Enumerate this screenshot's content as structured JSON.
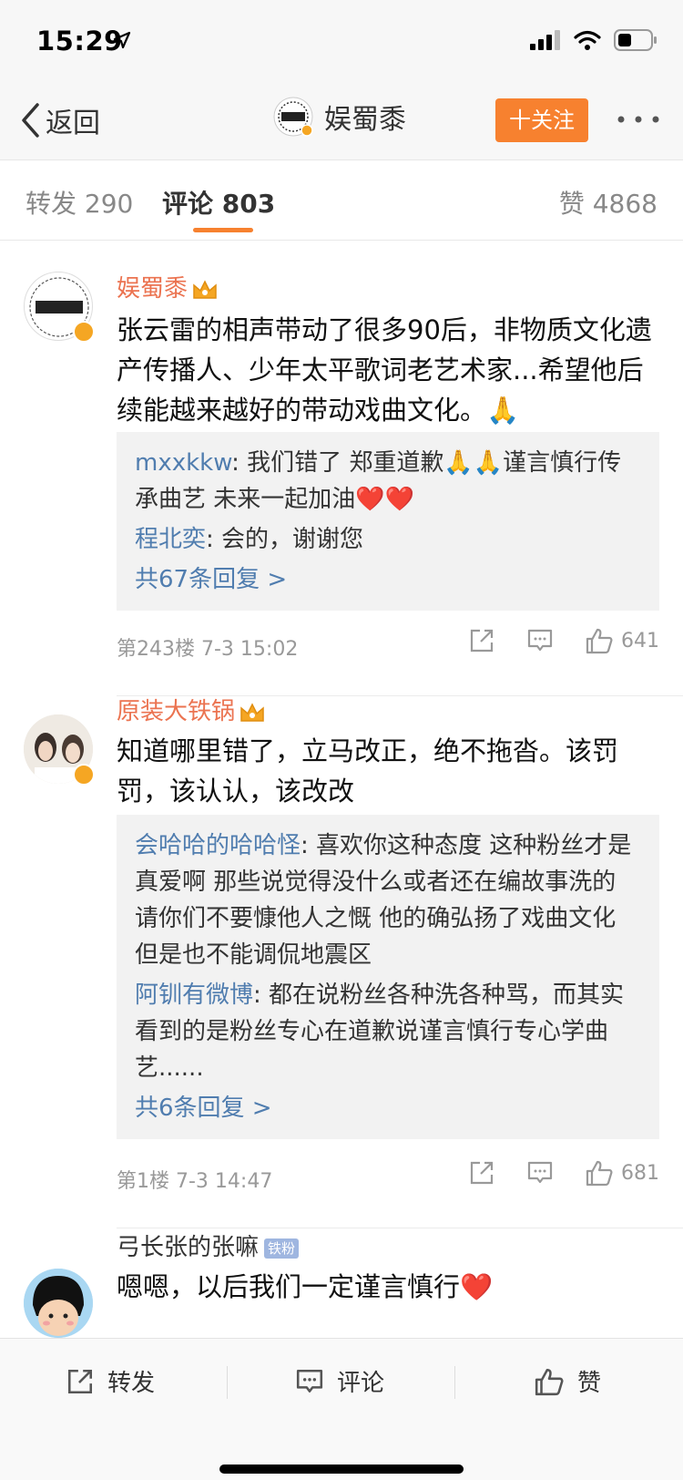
{
  "status": {
    "time": "15:29"
  },
  "nav": {
    "back_label": "返回",
    "title": "娱蜀黍",
    "follow_label": "十关注"
  },
  "tabs": [
    {
      "label": "转发 290"
    },
    {
      "label": "评论 803"
    },
    {
      "label": "赞 4868"
    }
  ],
  "comments": [
    {
      "user": "娱蜀黍",
      "content": "张云雷的相声带动了很多90后，非物质文化遗产传播人、少年太平歌词老艺术家...希望他后续能越来越好的带动戏曲文化。🙏",
      "replies": [
        {
          "name": "mxxkkw",
          "text": ": 我们错了 郑重道歉🙏🙏谨言慎行传承曲艺 未来一起加油❤️❤️"
        },
        {
          "name": "程北奕",
          "text": ": 会的，谢谢您"
        }
      ],
      "more": "共67条回复 >",
      "meta": "第243楼 7-3 15:02",
      "likes": "641"
    },
    {
      "user": "原装大铁锅",
      "content": "知道哪里错了，立马改正，绝不拖沓。该罚罚，该认认，该改改",
      "replies": [
        {
          "name": "会哈哈的哈哈怪",
          "text": ": 喜欢你这种态度 这种粉丝才是真爱啊 那些说觉得没什么或者还在编故事洗的 请你们不要慷他人之慨 他的确弘扬了戏曲文化 但是也不能调侃地震区"
        },
        {
          "name": "阿钏有微博",
          "text": ": 都在说粉丝各种洗各种骂，而其实看到的是粉丝专心在道歉说谨言慎行专心学曲艺......"
        }
      ],
      "more": "共6条回复 >",
      "meta": "第1楼 7-3 14:47",
      "likes": "681"
    },
    {
      "user": "弓长张的张嘛",
      "badge": "铁粉",
      "content": "嗯嗯，以后我们一定谨言慎行❤️"
    }
  ],
  "bottom": {
    "repost": "转发",
    "comment": "评论",
    "like": "赞"
  },
  "colors": {
    "accent": "#f7812f",
    "username": "#eb7350",
    "reply_name": "#507daf",
    "vip": "#f5a623"
  }
}
